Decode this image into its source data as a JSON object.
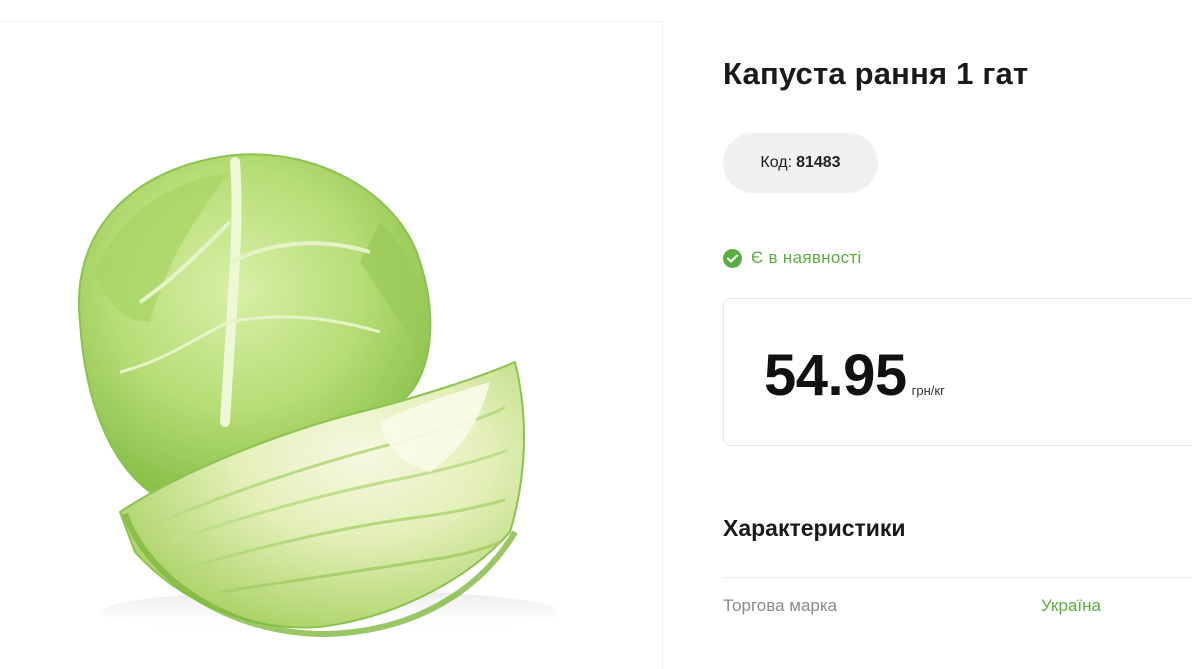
{
  "product": {
    "title": "Капуста рання 1 гат",
    "image_alt": "cabbage",
    "code_label": "Код:",
    "code_value": "81483",
    "availability": "Є в наявності",
    "price": "54.95",
    "price_unit": "грн/кг"
  },
  "specs": {
    "heading": "Характеристики",
    "rows": [
      {
        "label": "Торгова марка",
        "value": "Україна"
      }
    ]
  },
  "colors": {
    "accent_green": "#5aae3f",
    "pill_bg": "#f0f0f0",
    "border": "#e6e6e6"
  }
}
